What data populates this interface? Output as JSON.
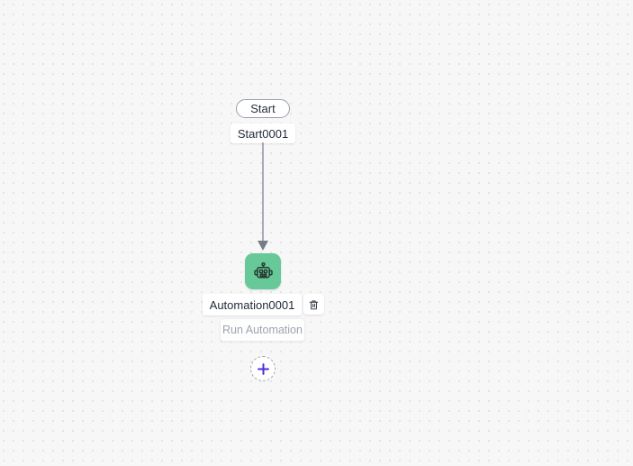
{
  "canvas": {
    "background_color": "#F7F7F8",
    "dot_color": "#E4E4E8"
  },
  "nodes": {
    "start": {
      "pill_label": "Start",
      "name": "Start0001"
    },
    "automation": {
      "name": "Automation0001",
      "tooltip": "Run Automation",
      "icon": "robot-icon",
      "color": "#68C998"
    }
  },
  "connector": {
    "type": "arrow-down",
    "color": "#868D96"
  },
  "controls": {
    "delete_icon": "trash-icon",
    "add_node_icon": "plus-icon",
    "plus_color": "#4F2BDB"
  }
}
